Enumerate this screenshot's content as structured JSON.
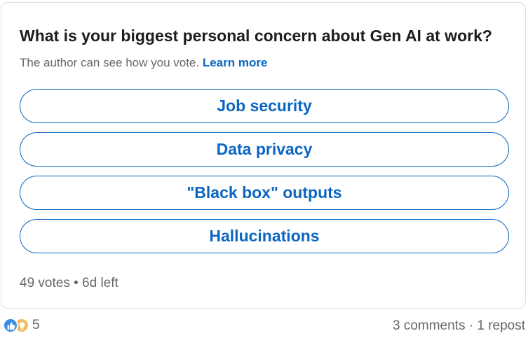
{
  "poll": {
    "question": "What is your biggest personal concern about Gen AI at work?",
    "note": "The author can see how you vote.",
    "learn_more": "Learn more",
    "options": [
      {
        "label": "Job security"
      },
      {
        "label": "Data privacy"
      },
      {
        "label": "\"Black box\" outputs"
      },
      {
        "label": "Hallucinations"
      }
    ],
    "votes": "49 votes",
    "separator": "•",
    "time_left": "6d left"
  },
  "social": {
    "reaction_icons": [
      "like-icon",
      "insightful-icon"
    ],
    "reaction_count": "5",
    "comments": "3 comments",
    "dot": "·",
    "reposts": "1 repost"
  },
  "colors": {
    "accent": "#0a66c2",
    "muted_text": "#666666",
    "like": "#378fe9",
    "insightful": "#f5bb5c"
  }
}
